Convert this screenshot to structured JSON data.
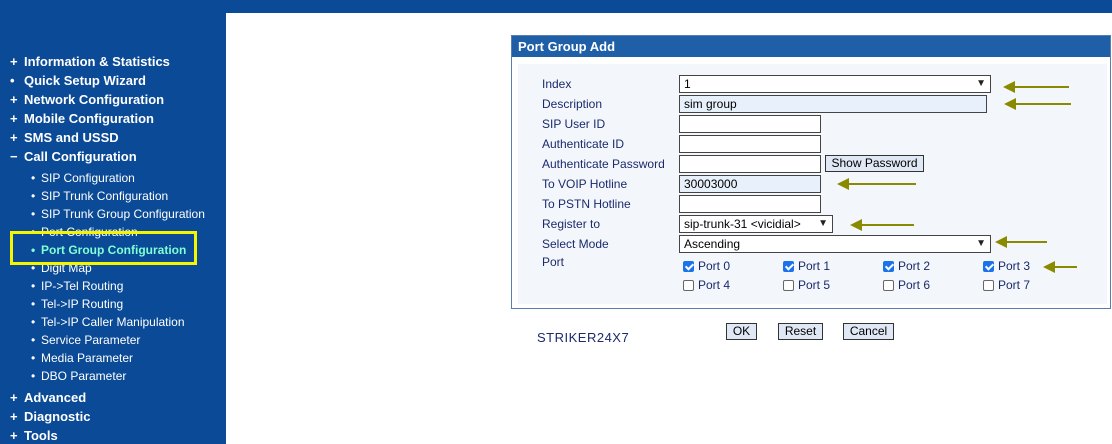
{
  "sidebar": {
    "top_items": [
      {
        "mark": "+",
        "label": "Information & Statistics"
      },
      {
        "mark": "+",
        "label": "Quick Setup Wizard"
      },
      {
        "mark": "+",
        "label": "Network Configuration"
      },
      {
        "mark": "+",
        "label": "Mobile Configuration"
      },
      {
        "mark": "+",
        "label": "SMS and USSD"
      },
      {
        "mark": "−",
        "label": "Call Configuration"
      }
    ],
    "sub_items": [
      {
        "dot": "•",
        "label": "SIP Configuration"
      },
      {
        "dot": "•",
        "label": "SIP Trunk Configuration"
      },
      {
        "dot": "•",
        "label": "SIP Trunk Group Configuration"
      },
      {
        "dot": "•",
        "label": "Port Configuration"
      },
      {
        "dot": "•",
        "label": "Port Group Configuration"
      },
      {
        "dot": "•",
        "label": "Digit Map"
      },
      {
        "dot": "•",
        "label": "IP->Tel Routing"
      },
      {
        "dot": "•",
        "label": "Tel->IP Routing"
      },
      {
        "dot": "•",
        "label": "Tel->IP Caller Manipulation"
      },
      {
        "dot": "•",
        "label": "Service Parameter"
      },
      {
        "dot": "•",
        "label": "Media Parameter"
      },
      {
        "dot": "•",
        "label": "DBO Parameter"
      }
    ],
    "bottom_items": [
      {
        "mark": "+",
        "label": "Advanced"
      },
      {
        "mark": "+",
        "label": "Diagnostic"
      },
      {
        "mark": "+",
        "label": "Tools"
      }
    ]
  },
  "panel": {
    "title": "Port Group Add",
    "labels": {
      "index": "Index",
      "description": "Description",
      "sip_user_id": "SIP User ID",
      "authenticate_id": "Authenticate ID",
      "authenticate_password": "Authenticate Password",
      "to_voip_hotline": "To VOIP Hotline",
      "to_pstn_hotline": "To PSTN Hotline",
      "register_to": "Register to",
      "select_mode": "Select Mode",
      "port": "Port"
    },
    "values": {
      "index": "1",
      "description": "sim group",
      "sip_user_id": "",
      "authenticate_id": "",
      "authenticate_password": "",
      "to_voip_hotline": "30003000",
      "to_pstn_hotline": "",
      "register_to": "sip-trunk-31 <vicidial>",
      "select_mode": "Ascending"
    },
    "show_password_label": "Show Password",
    "ports": [
      {
        "label": "Port 0",
        "checked": true
      },
      {
        "label": "Port 1",
        "checked": true
      },
      {
        "label": "Port 2",
        "checked": true
      },
      {
        "label": "Port 3",
        "checked": true
      },
      {
        "label": "Port 4",
        "checked": false
      },
      {
        "label": "Port 5",
        "checked": false
      },
      {
        "label": "Port 6",
        "checked": false
      },
      {
        "label": "Port 7",
        "checked": false
      }
    ]
  },
  "footer": {
    "brand": "STRIKER24X7",
    "ok_label": "OK",
    "reset_label": "Reset",
    "cancel_label": "Cancel"
  },
  "colors": {
    "sidebar_bg": "#0a4a96",
    "panel_title_bg": "#1f5fa8",
    "active_item": "#7fffd4",
    "highlight_box": "#f5f500",
    "annotation_arrow": "#8a8a00"
  }
}
